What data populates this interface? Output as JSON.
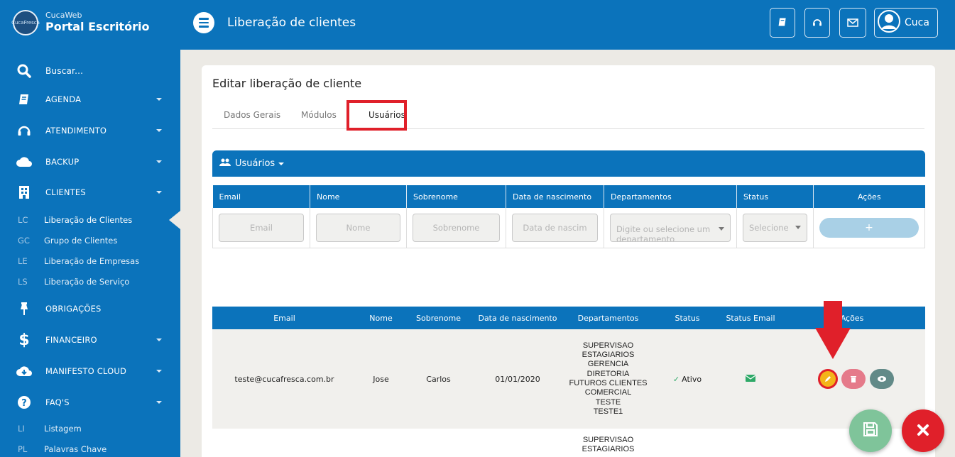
{
  "brand": {
    "sub": "CucaWeb",
    "main": "Portal Escritório",
    "logo_text": "CucaFresca"
  },
  "search": {
    "label": "Buscar..."
  },
  "menu": {
    "agenda": "AGENDA",
    "atendimento": "ATENDIMENTO",
    "backup": "BACKUP",
    "clientes": "CLIENTES",
    "obrigacoes": "OBRIGAÇÕES",
    "financeiro": "FINANCEIRO",
    "manifesto": "MANIFESTO CLOUD",
    "faqs": "FAQ'S"
  },
  "clientes_sub": [
    {
      "abbr": "LC",
      "label": "Liberação de Clientes"
    },
    {
      "abbr": "GC",
      "label": "Grupo de Clientes"
    },
    {
      "abbr": "LE",
      "label": "Liberação de Empresas"
    },
    {
      "abbr": "LS",
      "label": "Liberação de Serviço"
    }
  ],
  "faq_sub": [
    {
      "abbr": "LI",
      "label": "Listagem"
    },
    {
      "abbr": "PL",
      "label": "Palavras Chave"
    }
  ],
  "header": {
    "title": "Liberação de clientes",
    "user": "Cuca"
  },
  "card": {
    "title": "Editar liberação de cliente"
  },
  "tabs": [
    "Dados Gerais",
    "Módulos",
    "Usuários"
  ],
  "panel": {
    "title": "Usuários"
  },
  "form": {
    "headers": [
      "Email",
      "Nome",
      "Sobrenome",
      "Data de nascimento",
      "Departamentos",
      "Status",
      "Ações"
    ],
    "placeholders": {
      "email": "Email",
      "nome": "Nome",
      "sobrenome": "Sobrenome",
      "nascimento": "Data de nascim",
      "departamentos": "Digite ou selecione um departamento",
      "status": "Selecione"
    },
    "add_label": "+"
  },
  "list": {
    "headers": [
      "Email",
      "Nome",
      "Sobrenome",
      "Data de nascimento",
      "Departamentos",
      "Status",
      "Status Email",
      "Ações"
    ],
    "rows": [
      {
        "email": "teste@cucafresca.com.br",
        "nome": "Jose",
        "sobrenome": "Carlos",
        "nascimento": "01/01/2020",
        "departamentos": [
          "SUPERVISAO",
          "ESTAGIARIOS",
          "GERENCIA",
          "DIRETORIA",
          "FUTUROS CLIENTES",
          "COMERCIAL",
          "TESTE",
          "TESTE1"
        ],
        "status": "Ativo"
      },
      {
        "departamentos": [
          "SUPERVISAO",
          "ESTAGIARIOS"
        ]
      }
    ]
  },
  "colors": {
    "primary": "#0b73bb",
    "highlight": "#e0202a",
    "success": "#2fa968"
  },
  "icons": [
    "search-icon",
    "book-icon",
    "headset-icon",
    "cloud-icon",
    "building-icon",
    "pin-icon",
    "dollar-icon",
    "cloud-download-icon",
    "question-icon",
    "envelope-icon",
    "user-avatar-icon",
    "users-icon",
    "pencil-icon",
    "trash-icon",
    "eye-icon",
    "save-icon",
    "close-icon"
  ]
}
